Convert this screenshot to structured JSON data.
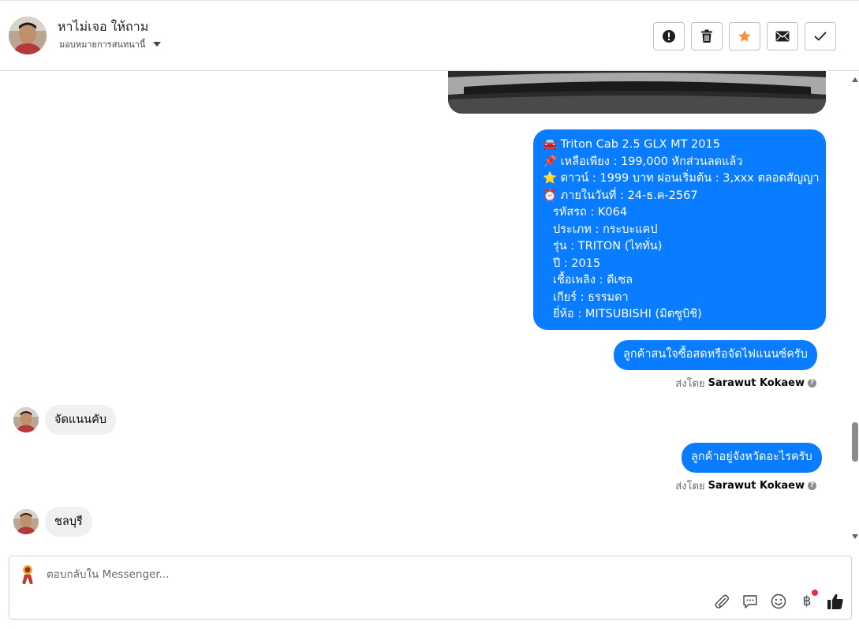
{
  "header": {
    "contact_name": "หาไม่เจอ ให้ถาม",
    "assign_label": "มอบหมายการสนทนานี้",
    "actions": [
      {
        "name": "spam-button",
        "icon": "exclamation-circle-icon"
      },
      {
        "name": "delete-button",
        "icon": "trash-icon"
      },
      {
        "name": "star-button",
        "icon": "star-icon",
        "color": "#f7923b"
      },
      {
        "name": "mark-unread-button",
        "icon": "envelope-icon"
      },
      {
        "name": "done-button",
        "icon": "checkmark-icon"
      }
    ]
  },
  "conversation": {
    "details_lines": [
      "🚘 Triton Cab 2.5 GLX MT 2015",
      "📌 เหลือเพียง : 199,000 หักส่วนลดแล้ว",
      "⭐ ดาวน์ : 1999 บาท ผ่อนเริ่มต้น : 3,xxx ตลอดสัญญา",
      "⏰ ภายในวันที่ : 24-ธ.ค-2567",
      "รหัสรถ : K064",
      "ประเภท : กระบะแคป",
      "รุ่น : TRITON (ไททั่น)",
      "ปี : 2015",
      "เชื้อเพลิง : ดีเซล",
      "เกียร์ : ธรรมดา",
      "ยี่ห้อ : MITSUBISHI (มิตซูบิชิ)"
    ],
    "q1_text": "ลูกค้าสนใจซื้อสดหรือจัดไฟแนนซ์ครับ",
    "q2_text": "ลูกค้าอยู่จังหวัดอะไรครับ",
    "sent_by_prefix": "ส่งโดย",
    "sent_by_name": "Sarawut Kokaew",
    "help_glyph": "?",
    "reply1_text": "จัดแนนคับ",
    "reply2_text": "ชลบุรี"
  },
  "composer": {
    "placeholder": "ตอบกลับใน Messenger...",
    "baht_symbol": "฿",
    "tools": [
      "paperclip-icon",
      "saved-replies-icon",
      "emoji-icon",
      "payment-icon",
      "thumbs-up-icon"
    ]
  },
  "colors": {
    "outgoing_bubble": "#0a7cff",
    "incoming_bubble": "#f0f0f0",
    "notification_dot": "#f02849",
    "star": "#f7923b"
  }
}
